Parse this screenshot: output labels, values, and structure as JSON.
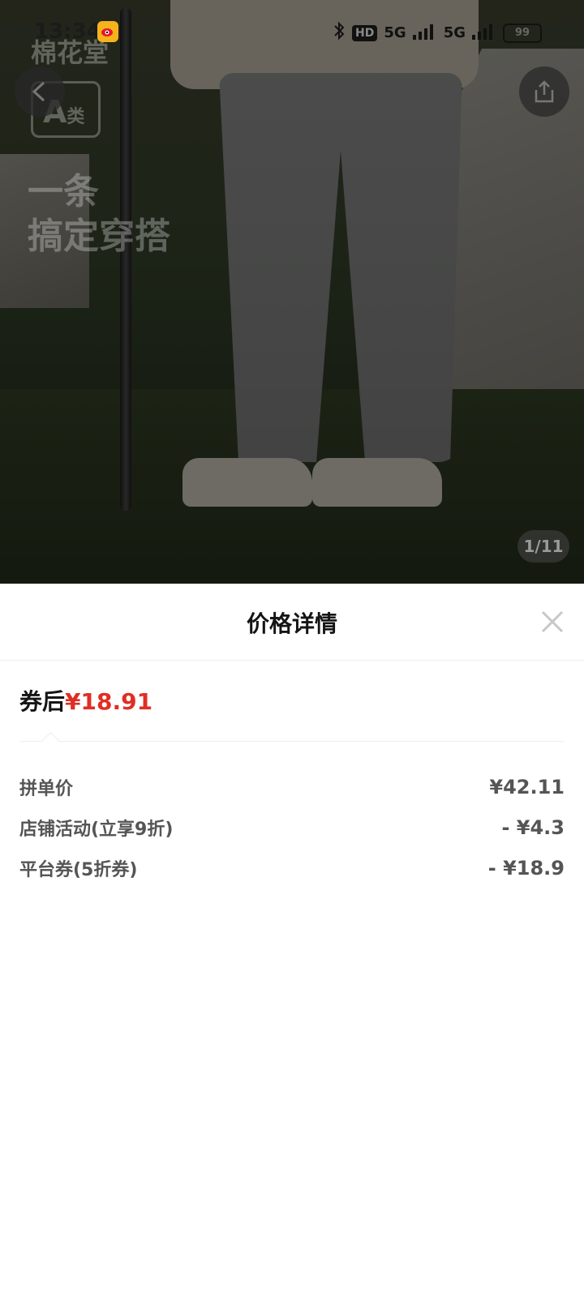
{
  "status_bar": {
    "time": "13:34",
    "network_a": "5G",
    "network_b": "5G",
    "hd_label": "HD",
    "battery": "99"
  },
  "product_image": {
    "brand_watermark": "棉花堂",
    "category_badge_letter": "A",
    "category_badge_text": "类",
    "slogan_line1": "一条",
    "slogan_line2": "搞定穿搭",
    "image_counter": "1/11"
  },
  "price_sheet": {
    "title": "价格详情",
    "after_coupon_label": "券后",
    "after_coupon_price": "¥18.91",
    "items": [
      {
        "label": "拼单价",
        "value": "¥42.11"
      },
      {
        "label": "店铺活动(立享9折)",
        "value": "- ¥4.3"
      },
      {
        "label": "平台券(5折券)",
        "value": "- ¥18.9"
      }
    ]
  },
  "colors": {
    "accent_red": "#e02e24",
    "text_dark": "#151515",
    "text_gray": "#555555"
  },
  "icons": [
    "weibo-icon",
    "bluetooth-icon",
    "signal-icon",
    "battery-icon",
    "back-icon",
    "share-icon",
    "close-icon"
  ]
}
